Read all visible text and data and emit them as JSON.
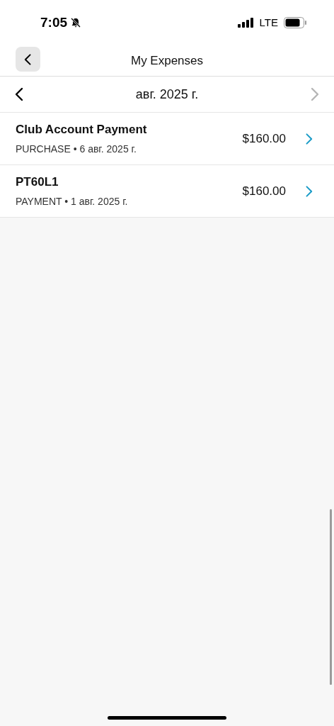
{
  "status_bar": {
    "time": "7:05",
    "network": "LTE"
  },
  "header": {
    "title": "My Expenses"
  },
  "month_nav": {
    "label": "авг. 2025 г.",
    "prev_disabled": false,
    "next_disabled": true
  },
  "expenses": [
    {
      "title": "Club Account Payment",
      "subtitle": "PURCHASE • 6 авг. 2025 г.",
      "amount": "$160.00"
    },
    {
      "title": "PT60L1",
      "subtitle": "PAYMENT • 1 авг. 2025 г.",
      "amount": "$160.00"
    }
  ]
}
